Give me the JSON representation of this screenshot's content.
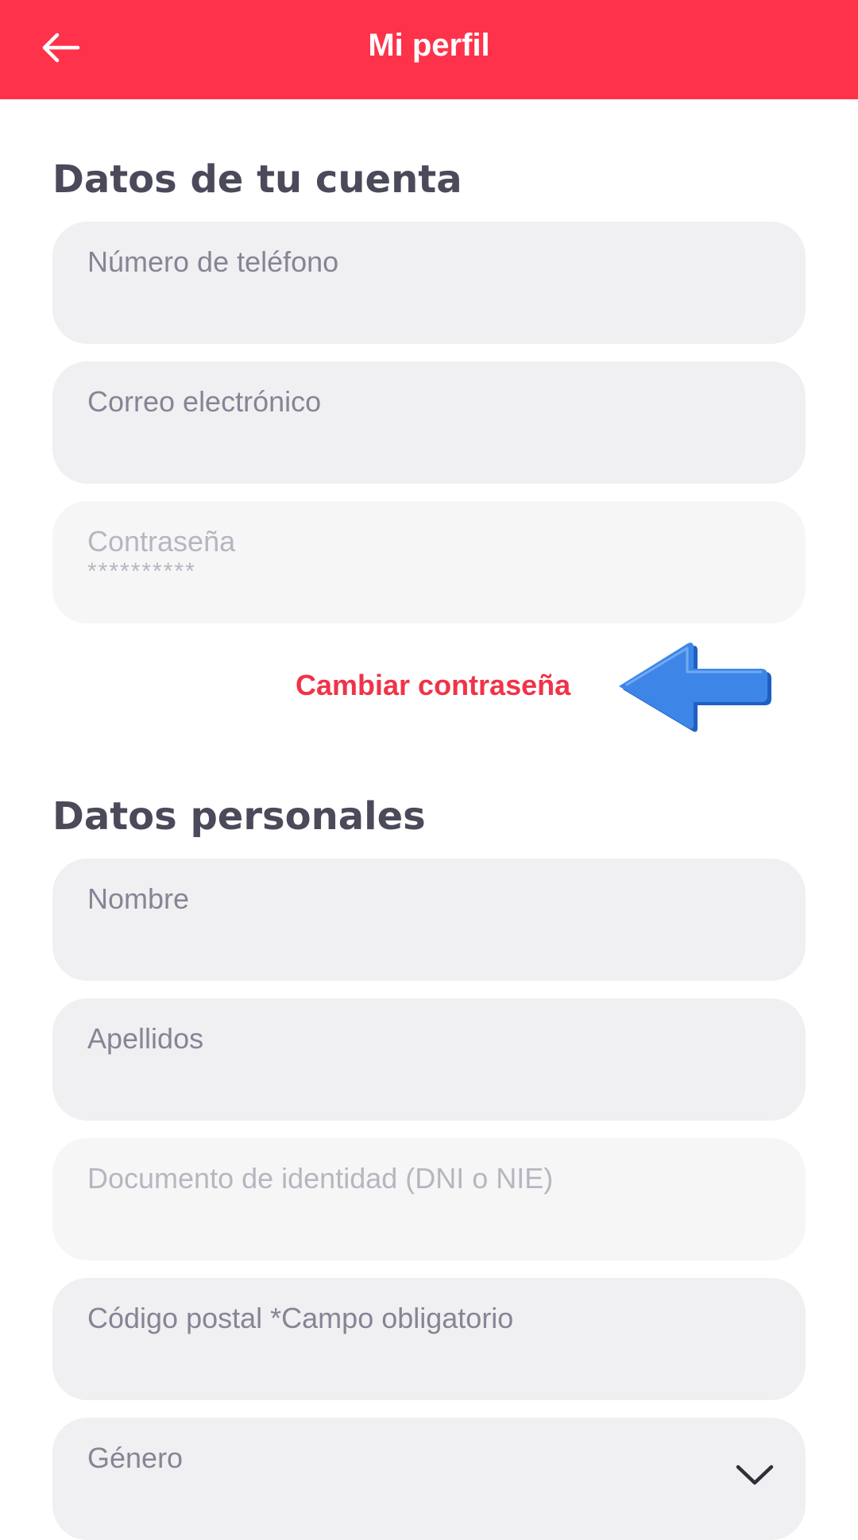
{
  "header": {
    "title": "Mi perfil",
    "back_icon": "arrow-left-icon"
  },
  "account_section": {
    "title": "Datos de tu cuenta",
    "fields": {
      "phone": {
        "label": "Número de teléfono",
        "value": ""
      },
      "email": {
        "label": "Correo electrónico",
        "value": ""
      },
      "password": {
        "label": "Contraseña",
        "value": "**********"
      }
    },
    "change_password_label": "Cambiar contraseña"
  },
  "personal_section": {
    "title": "Datos personales",
    "fields": {
      "first_name": {
        "label": "Nombre",
        "value": ""
      },
      "last_name": {
        "label": "Apellidos",
        "value": ""
      },
      "id_document": {
        "label": "Documento de identidad (DNI o NIE)",
        "value": ""
      },
      "postal_code": {
        "label": "Código postal  *Campo obligatorio",
        "value": ""
      },
      "gender": {
        "label": "Género",
        "value": ""
      }
    },
    "gender_icon": "chevron-down-icon"
  },
  "colors": {
    "primary": "#fe334b",
    "link": "#f03348",
    "heading": "#4a4a5a",
    "field_bg": "#f0f0f2",
    "field_label": "#858596",
    "annotation_arrow": "#3d86e8"
  }
}
